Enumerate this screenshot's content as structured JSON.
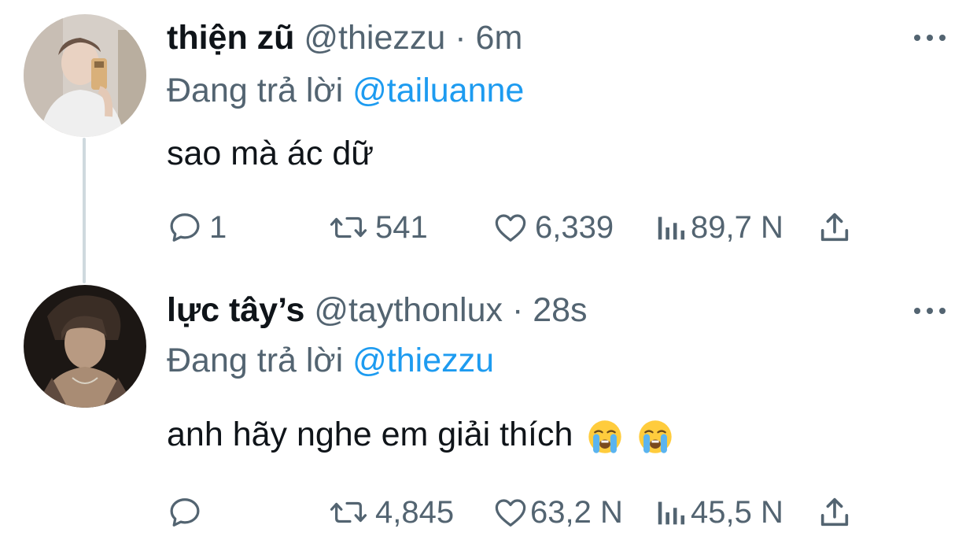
{
  "tweets": [
    {
      "display_name": "thiện zũ",
      "handle": "@thiezzu",
      "separator": "·",
      "time": "6m",
      "replying_prefix": "Đang trả lời",
      "replying_to": "@tailuanne",
      "text": "sao mà ác dữ",
      "replies": "1",
      "retweets": "541",
      "likes": "6,339",
      "views": "89,7 N"
    },
    {
      "display_name": "lực tây’s",
      "handle": "@taythonlux",
      "separator": "·",
      "time": "28s",
      "replying_prefix": "Đang trả lời",
      "replying_to": "@thiezzu",
      "text": "anh hãy nghe em giải thích",
      "emojis": [
        "loudly-crying-face",
        "loudly-crying-face"
      ],
      "replies": "",
      "retweets": "4,845",
      "likes": "63,2 N",
      "views": "45,5 N"
    }
  ],
  "colors": {
    "text": "#0f1419",
    "secondary": "#536471",
    "accent": "#1d9bf0",
    "thread_line": "#cfd9de"
  },
  "icons": [
    "more-icon",
    "reply-icon",
    "retweet-icon",
    "like-icon",
    "views-icon",
    "share-icon"
  ]
}
